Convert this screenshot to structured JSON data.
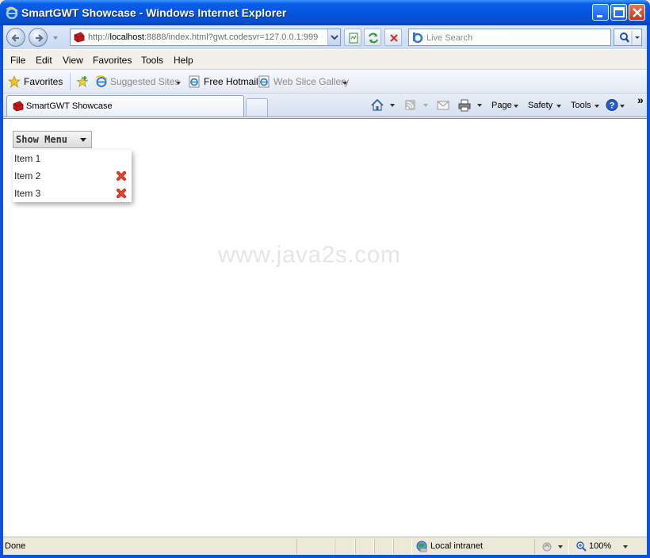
{
  "window": {
    "title": "SmartGWT Showcase - Windows Internet Explorer"
  },
  "address": {
    "url_prefix": "http://",
    "url_host": "localhost",
    "url_rest": ":8888/index.html?gwt.codesvr=127.0.0.1:999"
  },
  "search": {
    "placeholder": "Live Search"
  },
  "menubar": {
    "items": [
      "File",
      "Edit",
      "View",
      "Favorites",
      "Tools",
      "Help"
    ]
  },
  "favorites_bar": {
    "favorites_label": "Favorites",
    "suggested_sites": "Suggested Sites",
    "free_hotmail": "Free Hotmail",
    "web_slice_gallery": "Web Slice Gallery"
  },
  "tabs": {
    "active_tab": "SmartGWT Showcase"
  },
  "command_bar": {
    "page": "Page",
    "safety": "Safety",
    "tools": "Tools",
    "overflow": "»"
  },
  "page": {
    "show_menu_label": "Show Menu",
    "menu_items": [
      {
        "label": "Item 1",
        "removable": false
      },
      {
        "label": "Item 2",
        "removable": true
      },
      {
        "label": "Item 3",
        "removable": true
      }
    ],
    "watermark": "www.java2s.com"
  },
  "status": {
    "text": "Done",
    "zone": "Local intranet",
    "zoom": "100%"
  },
  "colors": {
    "title_bar": "#0453DC",
    "remove_icon": "#E8442A"
  }
}
